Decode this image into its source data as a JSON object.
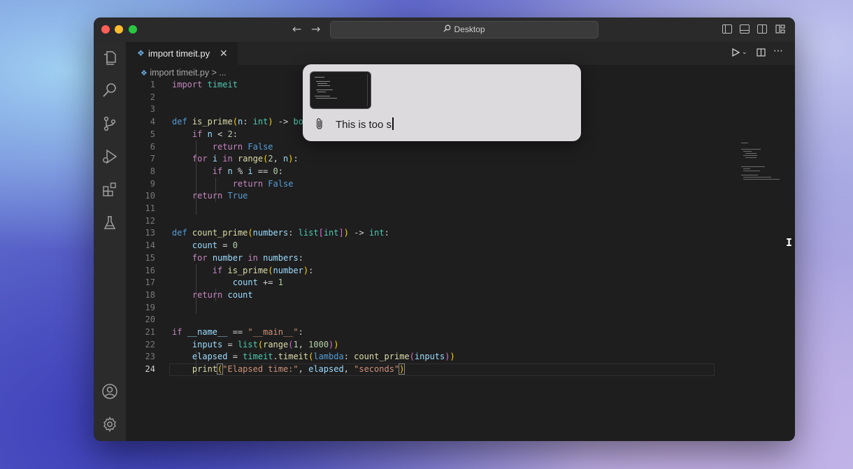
{
  "titlebar": {
    "back": "←",
    "forward": "→",
    "search_text": "Desktop"
  },
  "tab": {
    "label": "import timeit.py",
    "close": "✕"
  },
  "breadcrumb": {
    "file": "import timeit.py",
    "more": "> ..."
  },
  "editor": {
    "current_line": 24,
    "line_numbers": [
      "1",
      "2",
      "3",
      "4",
      "5",
      "6",
      "7",
      "8",
      "9",
      "10",
      "11",
      "12",
      "13",
      "14",
      "15",
      "16",
      "17",
      "18",
      "19",
      "20",
      "21",
      "22",
      "23",
      "24"
    ]
  },
  "popup": {
    "prompt_text": "This is too s"
  },
  "colors": {
    "editor_bg": "#1e1e1e",
    "keyword": "#569cd6",
    "control": "#c586c0",
    "function": "#dcdcaa",
    "string": "#ce9178",
    "number": "#b5cea8"
  },
  "icons": [
    "explorer-icon",
    "search-icon",
    "source-control-icon",
    "run-debug-icon",
    "extensions-icon",
    "testing-icon",
    "account-icon",
    "settings-icon",
    "paperclip-icon",
    "run-icon",
    "split-editor-icon",
    "more-icon"
  ]
}
